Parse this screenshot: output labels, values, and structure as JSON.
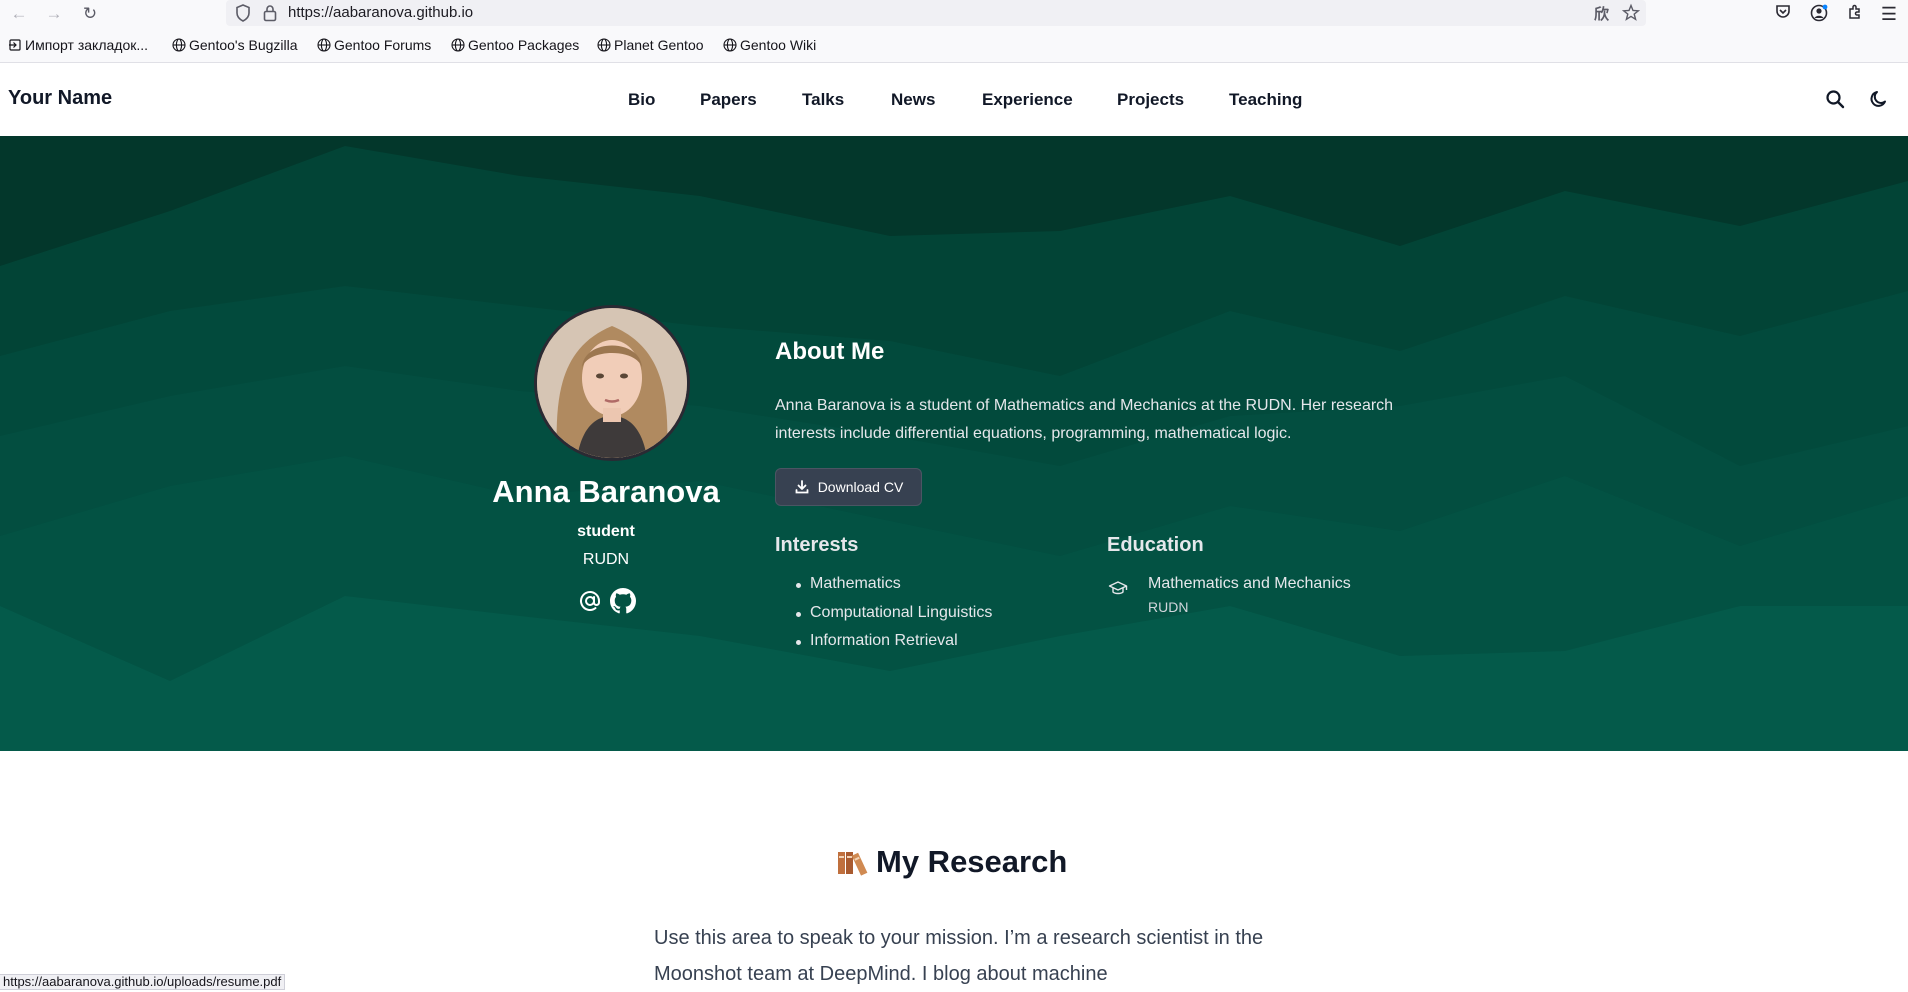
{
  "browser": {
    "url": "https://aabaranova.github.io",
    "bookmarks": [
      "Импорт закладок...",
      "Gentoo's Bugzilla",
      "Gentoo Forums",
      "Gentoo Packages",
      "Planet Gentoo",
      "Gentoo Wiki"
    ],
    "status_url": "https://aabaranova.github.io/uploads/resume.pdf"
  },
  "site": {
    "title": "Your Name",
    "nav": [
      "Bio",
      "Papers",
      "Talks",
      "News",
      "Experience",
      "Projects",
      "Teaching"
    ]
  },
  "profile": {
    "name": "Anna Baranova",
    "role": "student",
    "organization": "RUDN"
  },
  "about": {
    "heading": "About Me",
    "text": "Anna Baranova is a student of Mathematics and Mechanics at the RUDN. Her research interests include differential equations, programming, mathematical logic.",
    "download_label": "Download CV"
  },
  "interests": {
    "heading": "Interests",
    "items": [
      "Mathematics",
      "Computational Linguistics",
      "Information Retrieval"
    ]
  },
  "education": {
    "heading": "Education",
    "degree": "Mathematics and Mechanics",
    "school": "RUDN"
  },
  "research": {
    "heading": "My Research",
    "text": "Use this area to speak to your mission. I’m a research scientist in the Moonshot team at DeepMind. I blog about machine"
  },
  "colors": {
    "hero_dark": "#03372b",
    "hero_mid": "#024a3c",
    "hero_light": "#045a4a",
    "button_bg": "#374151"
  }
}
